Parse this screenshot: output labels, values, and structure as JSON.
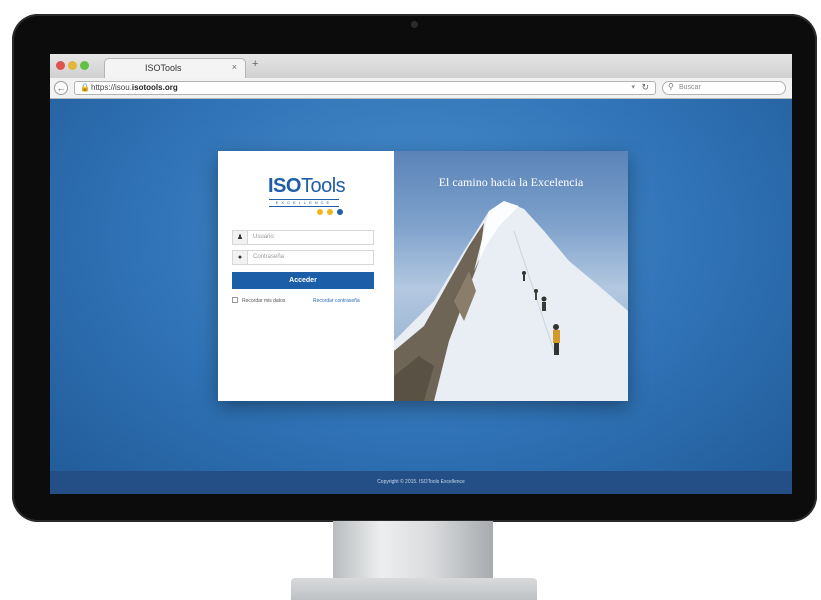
{
  "browser": {
    "tab_title": "ISOTools",
    "tab_close": "×",
    "new_tab": "+",
    "url_prefix": "https://isou.",
    "url_domain": "isotools.org",
    "search_placeholder": "Buscar"
  },
  "login": {
    "logo_bold": "ISO",
    "logo_normal": "Tools",
    "logo_sub": "EXCELLENCE",
    "logo_dot_colors": [
      "#f2b51c",
      "#f2b51c",
      "#1f5fa8"
    ],
    "username_placeholder": "Usuario",
    "password_placeholder": "Contraseña",
    "submit_label": "Acceder",
    "remember_label": "Recordar mis datos",
    "forgot_label": "Recordar contraseña",
    "tagline": "El camino hacia la Excelencia"
  },
  "footer": {
    "copyright": "Copyright © 2015. ISOTools Excellence"
  },
  "colors": {
    "brand_blue": "#1f5fa8",
    "accent_yellow": "#f2b51c",
    "page_background": "#2f72b5"
  }
}
